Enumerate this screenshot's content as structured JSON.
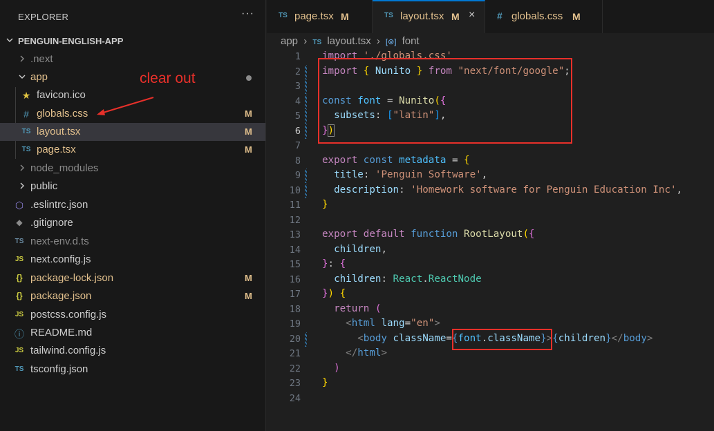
{
  "explorer": {
    "title": "EXPLORER",
    "more_icon": "···",
    "project_name": "PENGUIN-ENGLISH-APP",
    "items": [
      {
        "label": ".next",
        "status": "",
        "icon": "",
        "icon_name": "folder-chevron-right-icon"
      },
      {
        "label": "app",
        "status": "",
        "icon": "",
        "icon_name": "folder-chevron-down-icon"
      },
      {
        "label": "favicon.ico",
        "status": "",
        "icon": "★",
        "icon_name": "star-icon"
      },
      {
        "label": "globals.css",
        "status": "M",
        "icon": "#",
        "icon_name": "css-file-icon"
      },
      {
        "label": "layout.tsx",
        "status": "M",
        "icon": "TS",
        "icon_name": "typescript-file-icon"
      },
      {
        "label": "page.tsx",
        "status": "M",
        "icon": "TS",
        "icon_name": "typescript-file-icon"
      },
      {
        "label": "node_modules",
        "status": "",
        "icon": "",
        "icon_name": "folder-chevron-right-icon"
      },
      {
        "label": "public",
        "status": "",
        "icon": "",
        "icon_name": "folder-chevron-right-icon"
      },
      {
        "label": ".eslintrc.json",
        "status": "",
        "icon": "⬡",
        "icon_name": "eslint-file-icon"
      },
      {
        "label": ".gitignore",
        "status": "",
        "icon": "◆",
        "icon_name": "git-file-icon"
      },
      {
        "label": "next-env.d.ts",
        "status": "",
        "icon": "TS",
        "icon_name": "typescript-file-icon"
      },
      {
        "label": "next.config.js",
        "status": "",
        "icon": "JS",
        "icon_name": "javascript-file-icon"
      },
      {
        "label": "package-lock.json",
        "status": "M",
        "icon": "{}",
        "icon_name": "json-file-icon"
      },
      {
        "label": "package.json",
        "status": "M",
        "icon": "{}",
        "icon_name": "json-file-icon"
      },
      {
        "label": "postcss.config.js",
        "status": "",
        "icon": "JS",
        "icon_name": "javascript-file-icon"
      },
      {
        "label": "README.md",
        "status": "",
        "icon": "ⓘ",
        "icon_name": "info-file-icon"
      },
      {
        "label": "tailwind.config.js",
        "status": "",
        "icon": "JS",
        "icon_name": "javascript-file-icon"
      },
      {
        "label": "tsconfig.json",
        "status": "",
        "icon": "TS",
        "icon_name": "tsconfig-file-icon"
      }
    ]
  },
  "annotation": {
    "text": "clear out"
  },
  "tabs": [
    {
      "icon": "TS",
      "label": "page.tsx",
      "status": "M"
    },
    {
      "icon": "TS",
      "label": "layout.tsx",
      "status": "M",
      "close": "×"
    },
    {
      "icon": "#",
      "label": "globals.css",
      "status": "M"
    }
  ],
  "breadcrumb": {
    "folder": "app",
    "file_icon": "TS",
    "file": "layout.tsx",
    "symbol_icon": "[⊚]",
    "symbol": "font",
    "separator": "›"
  },
  "editor": {
    "current_line": "6",
    "line_numbers": [
      "1",
      "2",
      "3",
      "4",
      "5",
      "6",
      "7",
      "8",
      "9",
      "10",
      "11",
      "12",
      "13",
      "14",
      "15",
      "16",
      "17",
      "18",
      "19",
      "20",
      "21",
      "22",
      "23",
      "24"
    ],
    "code": [
      "import './globals.css'",
      "import { Nunito } from \"next/font/google\";",
      "",
      "const font = Nunito({",
      "  subsets: [\"latin\"],",
      "})",
      "",
      "export const metadata = {",
      "  title: 'Penguin Software',",
      "  description: 'Homework software for Penguin Education Inc',",
      "}",
      "",
      "export default function RootLayout({",
      "  children,",
      "}: {",
      "  children: React.ReactNode",
      "}) {",
      "  return (",
      "    <html lang=\"en\">",
      "      <body className={font.className}>{children}</body>",
      "    </html>",
      "  )",
      "}",
      ""
    ]
  },
  "colors": {
    "annotation_red": "#e8302a",
    "modified_yellow": "#e2c08d",
    "active_tab_accent": "#0078d4"
  }
}
